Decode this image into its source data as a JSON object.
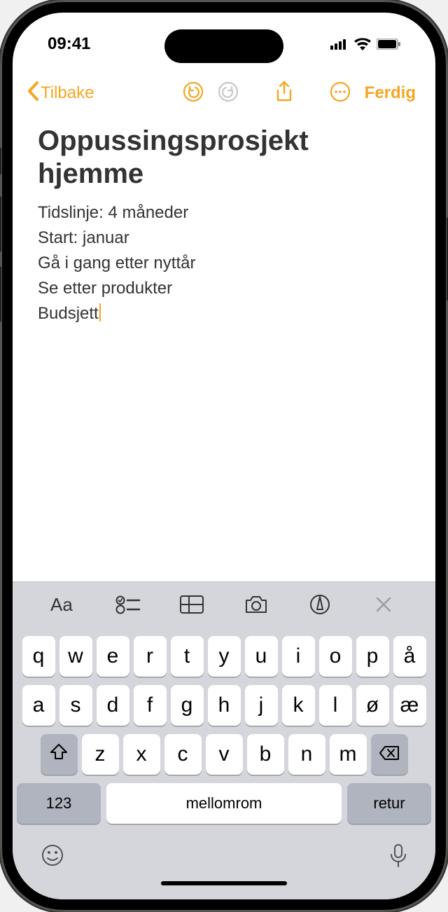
{
  "status": {
    "time": "09:41"
  },
  "nav": {
    "back_label": "Tilbake",
    "done_label": "Ferdig"
  },
  "note": {
    "title": "Oppussingsprosjekt hjemme",
    "lines": [
      "Tidslinje: 4 måneder",
      "Start: januar",
      "Gå i gang etter nyttår",
      "Se etter produkter",
      "Budsjett"
    ]
  },
  "keyboard": {
    "row1": [
      "q",
      "w",
      "e",
      "r",
      "t",
      "y",
      "u",
      "i",
      "o",
      "p",
      "å"
    ],
    "row2": [
      "a",
      "s",
      "d",
      "f",
      "g",
      "h",
      "j",
      "k",
      "l",
      "ø",
      "æ"
    ],
    "row3": [
      "z",
      "x",
      "c",
      "v",
      "b",
      "n",
      "m"
    ],
    "numbers_label": "123",
    "space_label": "mellomrom",
    "return_label": "retur"
  },
  "colors": {
    "accent": "#f5a623"
  }
}
